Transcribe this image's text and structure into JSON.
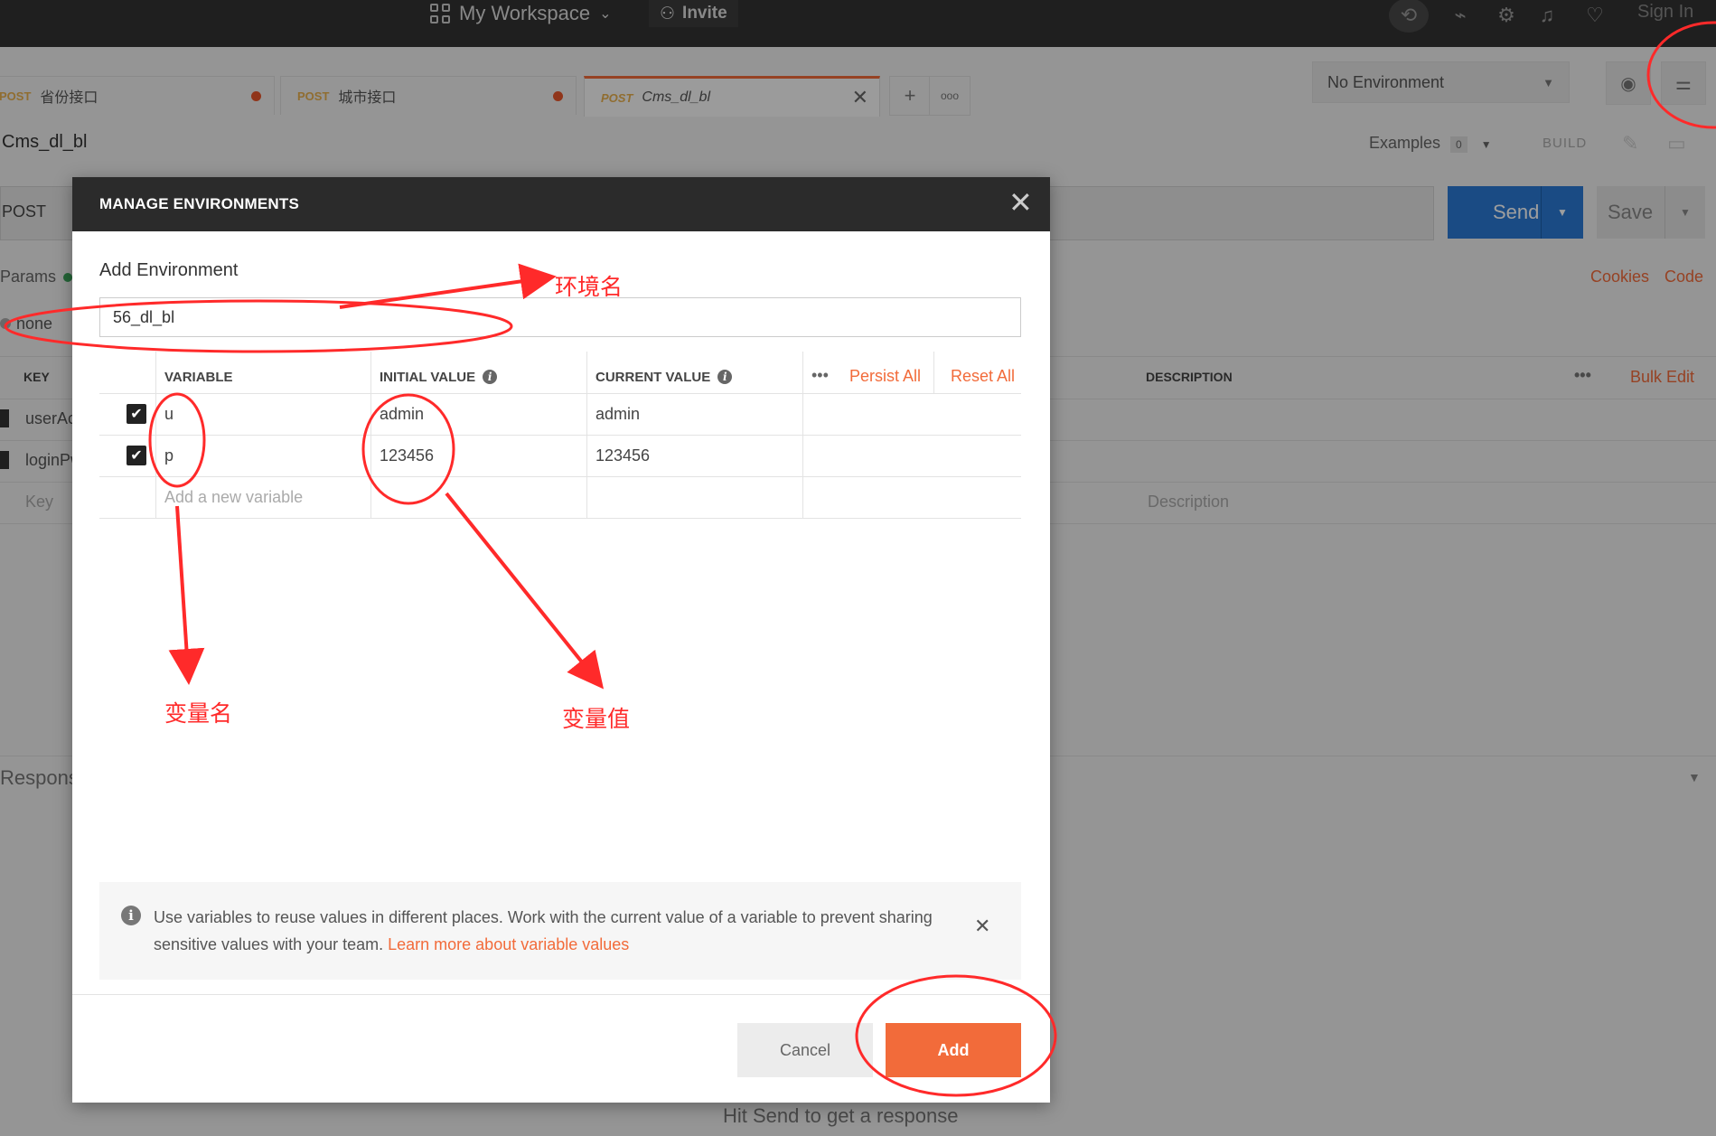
{
  "topbar": {
    "workspace_label": "My Workspace",
    "workspace_caret": "⌄",
    "invite_label": "Invite",
    "signin_label": "Sign In"
  },
  "tabs": [
    {
      "method": "POST",
      "name": "省份接口"
    },
    {
      "method": "POST",
      "name": "城市接口"
    },
    {
      "method": "POST",
      "name": "Cms_dl_bl"
    }
  ],
  "tab_more": "ooo",
  "environment": {
    "selected": "No Environment"
  },
  "request": {
    "name": "Cms_dl_bl",
    "method": "POST",
    "examples_label": "Examples",
    "examples_count": "0",
    "build_label": "BUILD",
    "send_label": "Send",
    "save_label": "Save",
    "params_label": "Params",
    "cookies_label": "Cookies",
    "code_label": "Code",
    "body_none": "none",
    "table_headers": {
      "key": "KEY",
      "description": "DESCRIPTION",
      "bulk_edit": "Bulk Edit"
    },
    "rows": [
      "userAccount",
      "loginPwd"
    ],
    "key_placeholder": "Key",
    "description_placeholder": "Description",
    "response_label": "Response",
    "hint": "Hit Send to get a response"
  },
  "modal": {
    "title": "MANAGE ENVIRONMENTS",
    "add_env_label": "Add Environment",
    "env_name": "56_dl_bl",
    "columns": {
      "variable": "VARIABLE",
      "initial": "INITIAL VALUE",
      "current": "CURRENT VALUE",
      "persist_all": "Persist All",
      "reset_all": "Reset All"
    },
    "variables": [
      {
        "name": "u",
        "initial": "admin",
        "current": "admin"
      },
      {
        "name": "p",
        "initial": "123456",
        "current": "123456"
      }
    ],
    "new_variable_placeholder": "Add a new variable",
    "info_text": "Use variables to reuse values in different places. Work with the current value of a variable to prevent sharing sensitive values with your team.",
    "info_link": "Learn more about variable values",
    "cancel_label": "Cancel",
    "add_label": "Add"
  },
  "annotations": {
    "env_name": "环境名",
    "variable_name": "变量名",
    "variable_value": "变量值"
  },
  "colors": {
    "accent": "#f26b3a",
    "send": "#2a7ad6",
    "annotation": "#ff2a2a"
  }
}
